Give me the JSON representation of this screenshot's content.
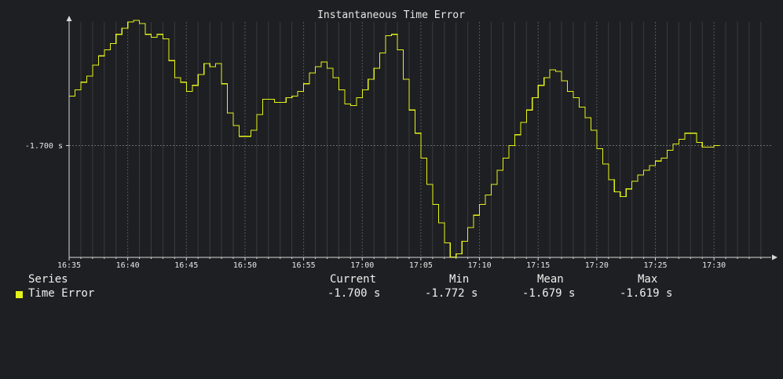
{
  "chart_data": {
    "type": "line",
    "title": "Instantaneous Time Error",
    "x_tick_labels": [
      "16:35",
      "16:40",
      "16:45",
      "16:50",
      "16:55",
      "17:00",
      "17:05",
      "17:10",
      "17:15",
      "17:20",
      "17:25",
      "17:30"
    ],
    "y_tick_labels": [
      "-1.700 s"
    ],
    "y_tick_values": [
      -1.7
    ],
    "x_range_minutes": [
      0,
      60
    ],
    "ylim": [
      -1.7784,
      -1.6088
    ],
    "grid": true,
    "step": true,
    "series": [
      {
        "name": "Time Error",
        "color": "#e3f21a",
        "x_minutes": [
          0,
          0.5,
          1,
          1.5,
          2,
          2.5,
          3,
          3.5,
          4,
          4.5,
          5,
          5.5,
          6,
          6.5,
          7,
          7.5,
          8,
          8.5,
          9,
          9.5,
          10,
          10.5,
          11,
          11.5,
          12,
          12.5,
          13,
          13.5,
          14,
          14.5,
          15,
          15.5,
          16,
          16.5,
          17,
          17.5,
          18,
          18.5,
          19,
          19.5,
          20,
          20.5,
          21,
          21.5,
          22,
          22.5,
          23,
          23.5,
          24,
          24.5,
          25,
          25.5,
          26,
          26.5,
          27,
          27.5,
          28,
          28.5,
          29,
          29.5,
          30,
          30.5,
          31,
          31.5,
          32,
          32.5,
          33,
          33.5,
          34,
          34.5,
          35,
          35.5,
          36,
          36.5,
          37,
          37.5,
          38,
          38.5,
          39,
          39.5,
          40,
          40.5,
          41,
          41.5,
          42,
          42.5,
          43,
          43.5,
          44,
          44.5,
          45,
          45.5,
          46,
          46.5,
          47,
          47.5,
          48,
          48.5,
          49,
          49.5,
          50,
          50.5,
          51,
          51.5,
          52,
          52.5,
          53,
          53.5,
          54,
          54.5,
          55,
          55.5,
          56,
          56.5,
          57,
          57.5,
          58,
          58.5,
          59,
          59.5
        ],
        "values": [
          -1.668,
          -1.664,
          -1.659,
          -1.655,
          -1.648,
          -1.642,
          -1.638,
          -1.634,
          -1.628,
          -1.624,
          -1.62,
          -1.619,
          -1.621,
          -1.628,
          -1.63,
          -1.628,
          -1.631,
          -1.645,
          -1.656,
          -1.659,
          -1.665,
          -1.661,
          -1.654,
          -1.647,
          -1.649,
          -1.647,
          -1.66,
          -1.679,
          -1.687,
          -1.694,
          -1.694,
          -1.69,
          -1.68,
          -1.67,
          -1.67,
          -1.672,
          -1.672,
          -1.669,
          -1.668,
          -1.665,
          -1.66,
          -1.653,
          -1.649,
          -1.646,
          -1.65,
          -1.656,
          -1.664,
          -1.673,
          -1.674,
          -1.669,
          -1.664,
          -1.657,
          -1.65,
          -1.64,
          -1.629,
          -1.628,
          -1.638,
          -1.657,
          -1.677,
          -1.692,
          -1.708,
          -1.725,
          -1.738,
          -1.75,
          -1.763,
          -1.772,
          -1.77,
          -1.762,
          -1.753,
          -1.745,
          -1.738,
          -1.732,
          -1.725,
          -1.716,
          -1.708,
          -1.7,
          -1.693,
          -1.685,
          -1.677,
          -1.669,
          -1.661,
          -1.656,
          -1.651,
          -1.652,
          -1.658,
          -1.665,
          -1.669,
          -1.675,
          -1.682,
          -1.69,
          -1.702,
          -1.712,
          -1.722,
          -1.73,
          -1.733,
          -1.728,
          -1.723,
          -1.719,
          -1.716,
          -1.713,
          -1.71,
          -1.708,
          -1.703,
          -1.699,
          -1.696,
          -1.692,
          -1.692,
          -1.698,
          -1.701,
          -1.701,
          -1.7
        ]
      }
    ]
  },
  "legend": {
    "headers": {
      "series": "Series",
      "current": "Current",
      "min": "Min",
      "mean": "Mean",
      "max": "Max"
    },
    "rows": [
      {
        "name": "Time Error",
        "color": "#e3f21a",
        "current": "-1.700 s",
        "min": "-1.772 s",
        "mean": "-1.679 s",
        "max": "-1.619 s"
      }
    ]
  }
}
